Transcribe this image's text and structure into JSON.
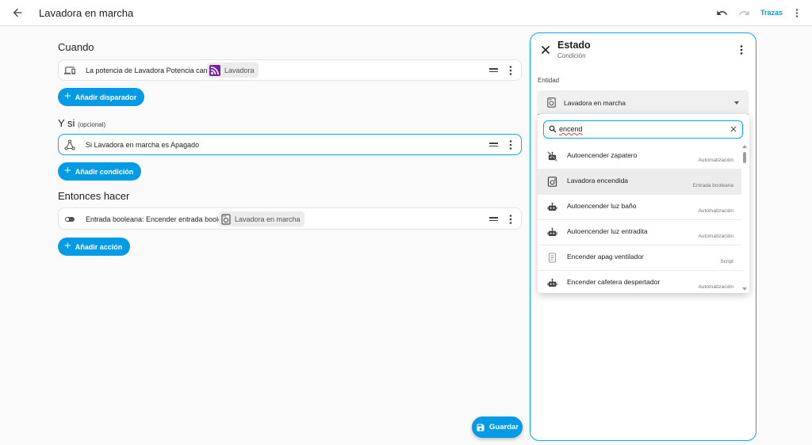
{
  "header": {
    "title": "Lavadora en marcha",
    "traces_label": "Trazas"
  },
  "editor": {
    "triggers": {
      "title": "Cuando",
      "items": [
        {
          "text": "La potencia de Lavadora Potencia cambia",
          "chip": "Lavadora"
        }
      ],
      "add_label": "Añadir disparador"
    },
    "conditions": {
      "title": "Y si",
      "optional": "(opcional)",
      "items": [
        {
          "text": "Si Lavadora en marcha es Apagado"
        }
      ],
      "add_label": "Añadir condición"
    },
    "actions": {
      "title": "Entonces hacer",
      "items": [
        {
          "text": "Entrada booleana: Encender entrada booleana",
          "chip": "Lavadora en marcha"
        }
      ],
      "add_label": "Añadir acción"
    },
    "save_label": "Guardar"
  },
  "panel": {
    "title": "Estado",
    "subtitle": "Condición",
    "entity_label": "Entidad",
    "entity_value": "Lavadora en marcha",
    "search_value": "encend",
    "results": [
      {
        "name": "Autoencender zapatero",
        "type": "Automatización",
        "icon": "robot-off-icon"
      },
      {
        "name": "Lavadora encendida",
        "type": "Entrada booleana",
        "icon": "washing-machine-icon"
      },
      {
        "name": "Autoencender luz baño",
        "type": "Automatización",
        "icon": "robot-icon"
      },
      {
        "name": "Autoencender luz entradita",
        "type": "Automatización",
        "icon": "robot-icon"
      },
      {
        "name": "Encender apag ventilador",
        "type": "Script",
        "icon": "script-icon"
      },
      {
        "name": "Encender cafetera despertador",
        "type": "Automatización",
        "icon": "robot-icon"
      }
    ]
  },
  "colors": {
    "accent": "#039be5",
    "selected_border": "#03a9f4",
    "highlight_row": "#ececec"
  }
}
